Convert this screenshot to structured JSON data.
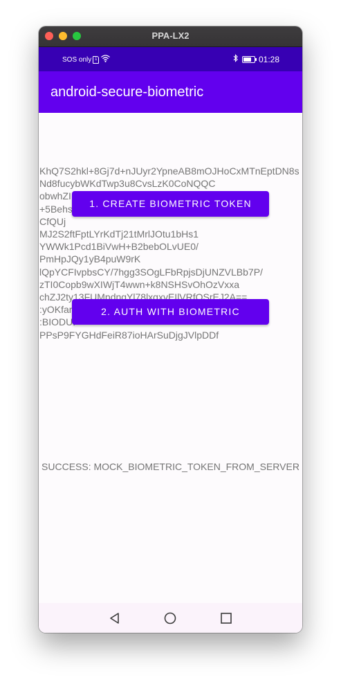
{
  "window": {
    "title": "PPA-LX2"
  },
  "status_bar": {
    "carrier": "SOS only",
    "time": "01:28",
    "sim_label": "1"
  },
  "app_bar": {
    "title": "android-secure-biometric"
  },
  "main": {
    "token_text": "KhQ7S2hkl+8Gj7d+nJUyr2YpneAB8mOJHoCxMTnEptDN8sNd8fucybWKdTwp3u8CvsLzK0CoNQQC\nobwhZI                                      \n+5Behs                                      Lmtff/\nCfQUj\nMJ2S2ftFptLYrKdTj21tMrlJOtu1bHs1\nYWWk1Pcd1BiVwH+B2bebOLvUE0/\nPmHpJQy1yB4puW9rK\nlQpYCFIvpbsCY/7hgg3SOgLFbRpjsDjUNZVLBb7P/\nzTI0Copb9wXIWjT4wwn+k8NSHSvOhOzVxxa\nchZJ2ty13FUMpdngYl78lxgxvEIlVRfOSrEJ2A==\n:yOKfar\n:BIODU.\nPPsP9FYGHdFeiR87ioHArSuDjgJVlpDDf",
    "create_button_label": "1. CREATE BIOMETRIC TOKEN",
    "auth_button_label": "2. AUTH WITH BIOMETRIC",
    "status_message": "SUCCESS: MOCK_BIOMETRIC_TOKEN_FROM_SERVER"
  },
  "nav_bar": {
    "back_icon": "triangle-back-icon",
    "home_icon": "circle-home-icon",
    "recents_icon": "square-recents-icon"
  },
  "colors": {
    "primary": "#6200ee",
    "primary_dark": "#3700b3",
    "text_secondary": "#757575"
  }
}
